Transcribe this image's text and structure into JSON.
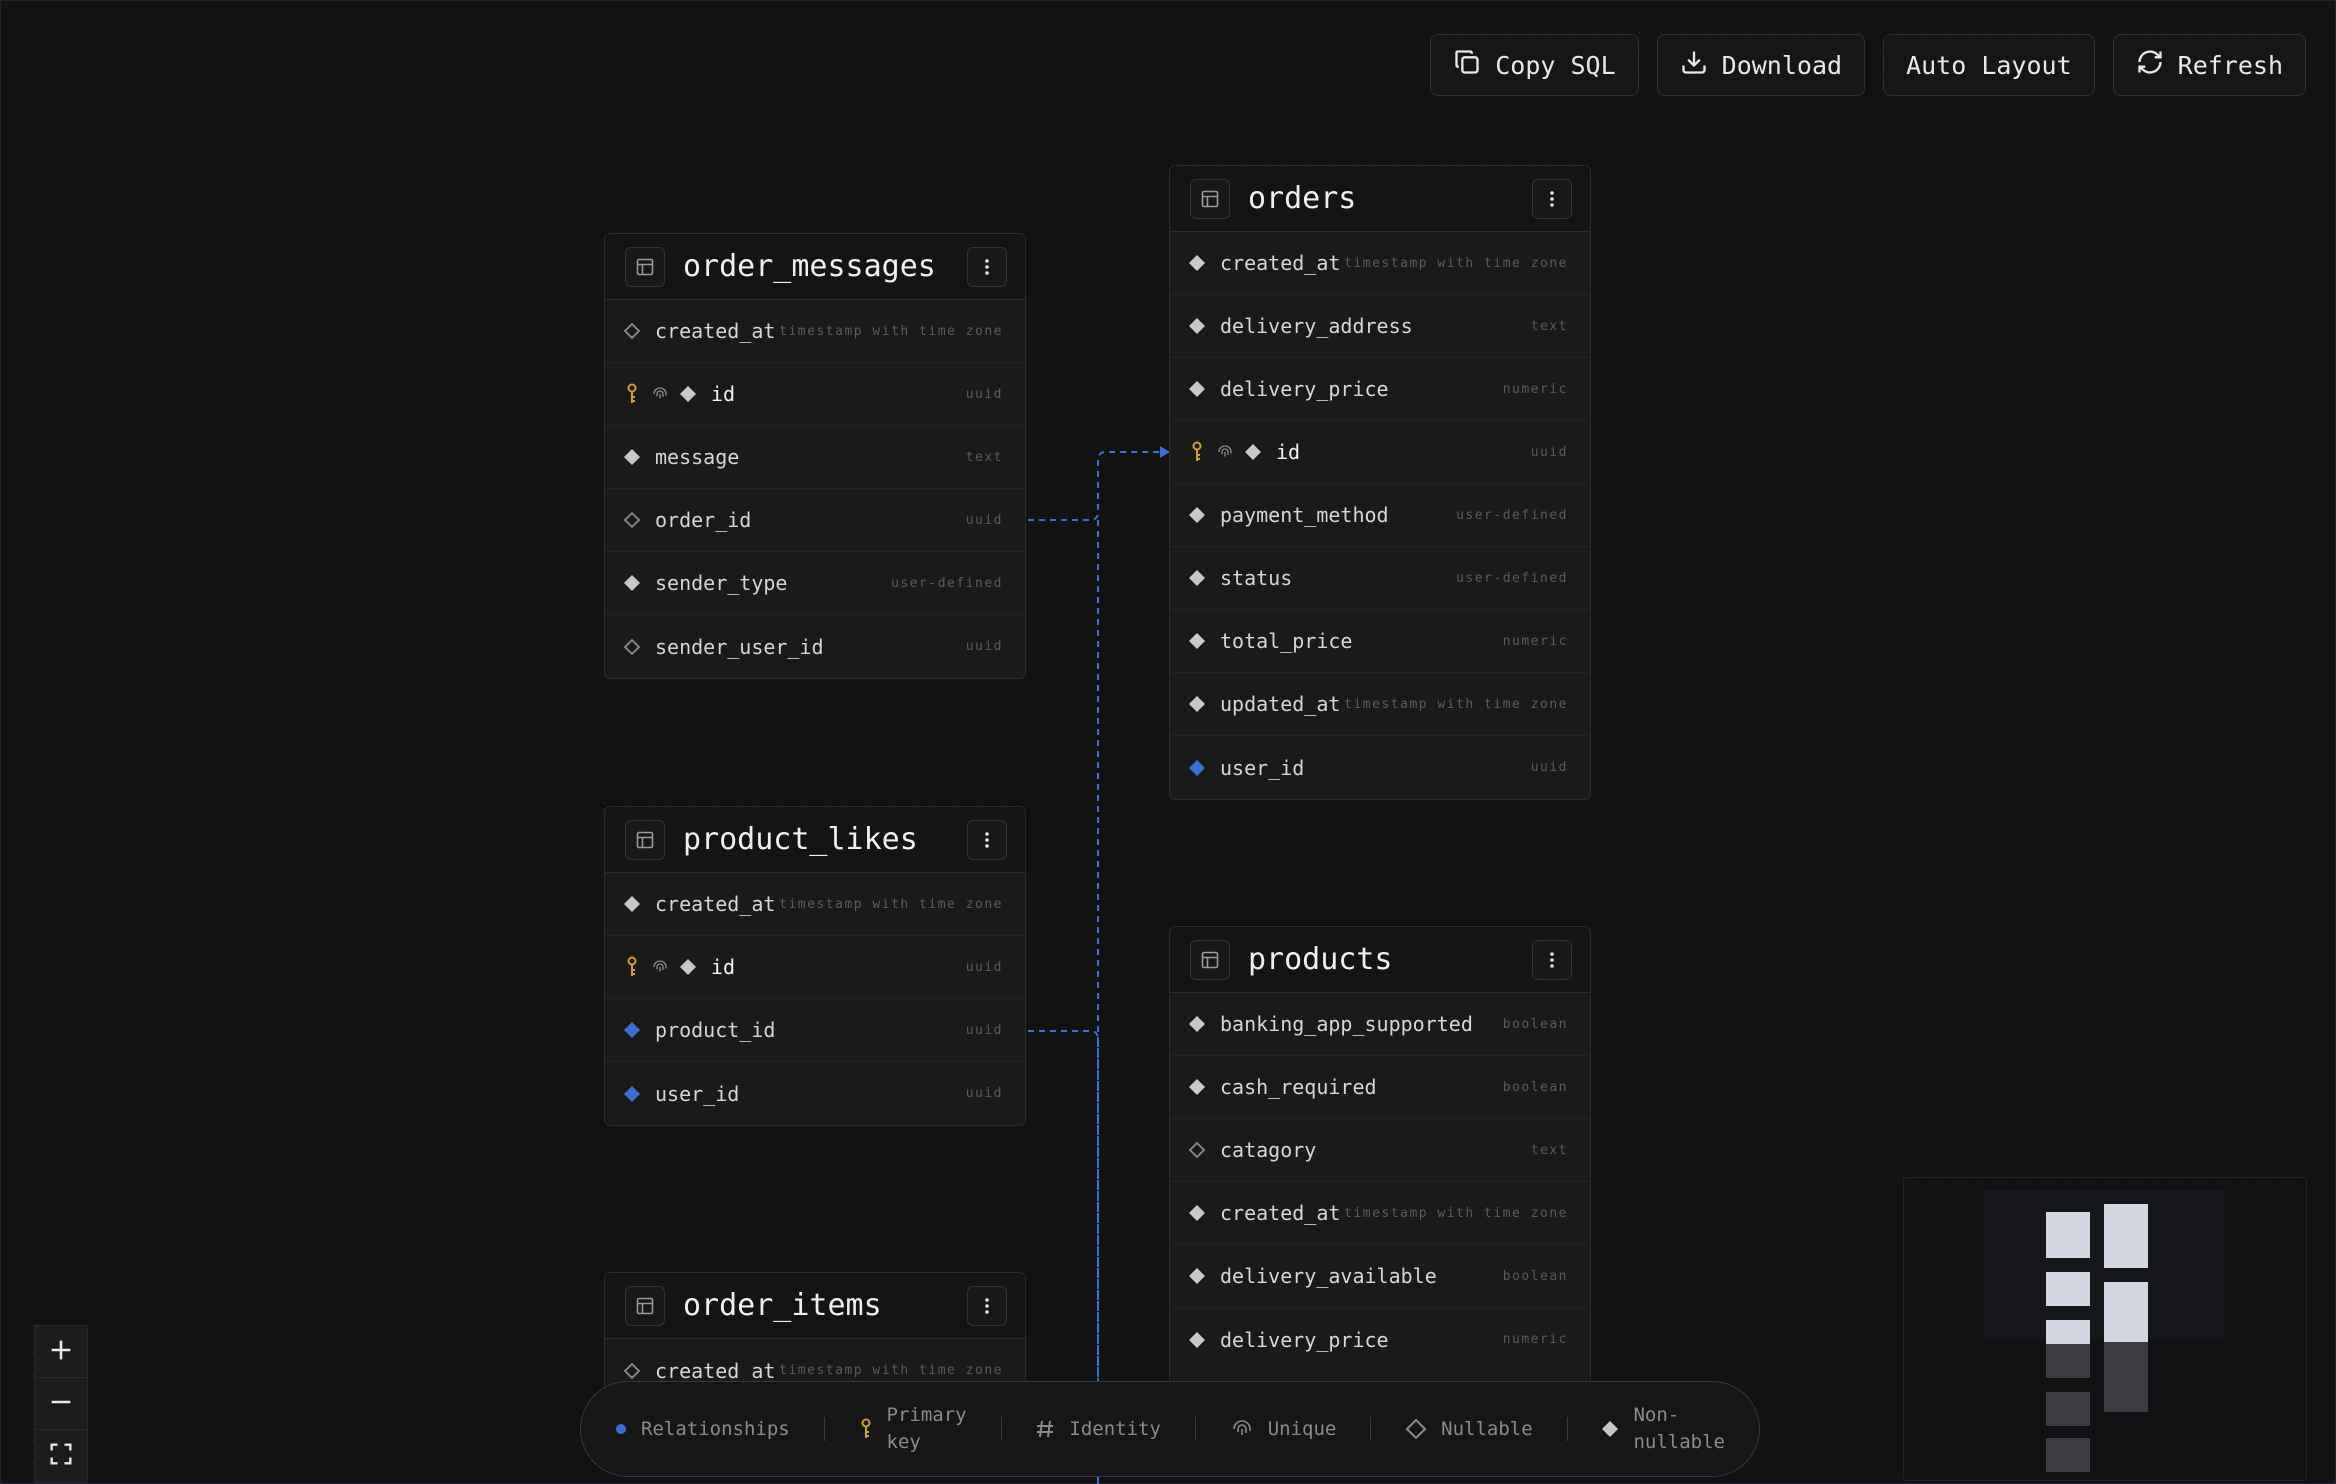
{
  "toolbar": {
    "copy_sql": "Copy SQL",
    "download": "Download",
    "auto_layout": "Auto Layout",
    "refresh": "Refresh"
  },
  "tables": {
    "order_messages": {
      "name": "order_messages",
      "columns": [
        {
          "name": "created_at",
          "type": "timestamp with time zone",
          "marker": "nullable"
        },
        {
          "name": "id",
          "type": "uuid",
          "marker": "non-nullable",
          "primary": true,
          "unique": true
        },
        {
          "name": "message",
          "type": "text",
          "marker": "non-nullable"
        },
        {
          "name": "order_id",
          "type": "uuid",
          "marker": "nullable"
        },
        {
          "name": "sender_type",
          "type": "user-defined",
          "marker": "non-nullable"
        },
        {
          "name": "sender_user_id",
          "type": "uuid",
          "marker": "nullable"
        }
      ]
    },
    "orders": {
      "name": "orders",
      "columns": [
        {
          "name": "created_at",
          "type": "timestamp with time zone",
          "marker": "non-nullable"
        },
        {
          "name": "delivery_address",
          "type": "text",
          "marker": "non-nullable"
        },
        {
          "name": "delivery_price",
          "type": "numeric",
          "marker": "non-nullable"
        },
        {
          "name": "id",
          "type": "uuid",
          "marker": "non-nullable",
          "primary": true,
          "unique": true
        },
        {
          "name": "payment_method",
          "type": "user-defined",
          "marker": "non-nullable"
        },
        {
          "name": "status",
          "type": "user-defined",
          "marker": "non-nullable"
        },
        {
          "name": "total_price",
          "type": "numeric",
          "marker": "non-nullable"
        },
        {
          "name": "updated_at",
          "type": "timestamp with time zone",
          "marker": "non-nullable"
        },
        {
          "name": "user_id",
          "type": "uuid",
          "marker": "relationship"
        }
      ]
    },
    "product_likes": {
      "name": "product_likes",
      "columns": [
        {
          "name": "created_at",
          "type": "timestamp with time zone",
          "marker": "non-nullable"
        },
        {
          "name": "id",
          "type": "uuid",
          "marker": "non-nullable",
          "primary": true,
          "unique": true
        },
        {
          "name": "product_id",
          "type": "uuid",
          "marker": "relationship"
        },
        {
          "name": "user_id",
          "type": "uuid",
          "marker": "relationship"
        }
      ]
    },
    "products": {
      "name": "products",
      "columns": [
        {
          "name": "banking_app_supported",
          "type": "boolean",
          "marker": "non-nullable"
        },
        {
          "name": "cash_required",
          "type": "boolean",
          "marker": "non-nullable"
        },
        {
          "name": "catagory",
          "type": "text",
          "marker": "nullable"
        },
        {
          "name": "created_at",
          "type": "timestamp with time zone",
          "marker": "non-nullable"
        },
        {
          "name": "delivery_available",
          "type": "boolean",
          "marker": "non-nullable"
        },
        {
          "name": "delivery_price",
          "type": "numeric",
          "marker": "non-nullable"
        }
      ]
    },
    "order_items": {
      "name": "order_items",
      "columns": [
        {
          "name": "created_at",
          "type": "timestamp with time zone",
          "marker": "nullable"
        }
      ]
    }
  },
  "legend": {
    "relationships": "Relationships",
    "primary_key_1": "Primary",
    "primary_key_2": "key",
    "identity": "Identity",
    "unique": "Unique",
    "nullable": "Nullable",
    "non_nullable_1": "Non-",
    "non_nullable_2": "nullable"
  },
  "colors": {
    "relationship": "#3b6fd4",
    "primary_key": "#d4a017",
    "non_nullable": "#c8c8c8",
    "nullable": "#8a8a8a"
  }
}
